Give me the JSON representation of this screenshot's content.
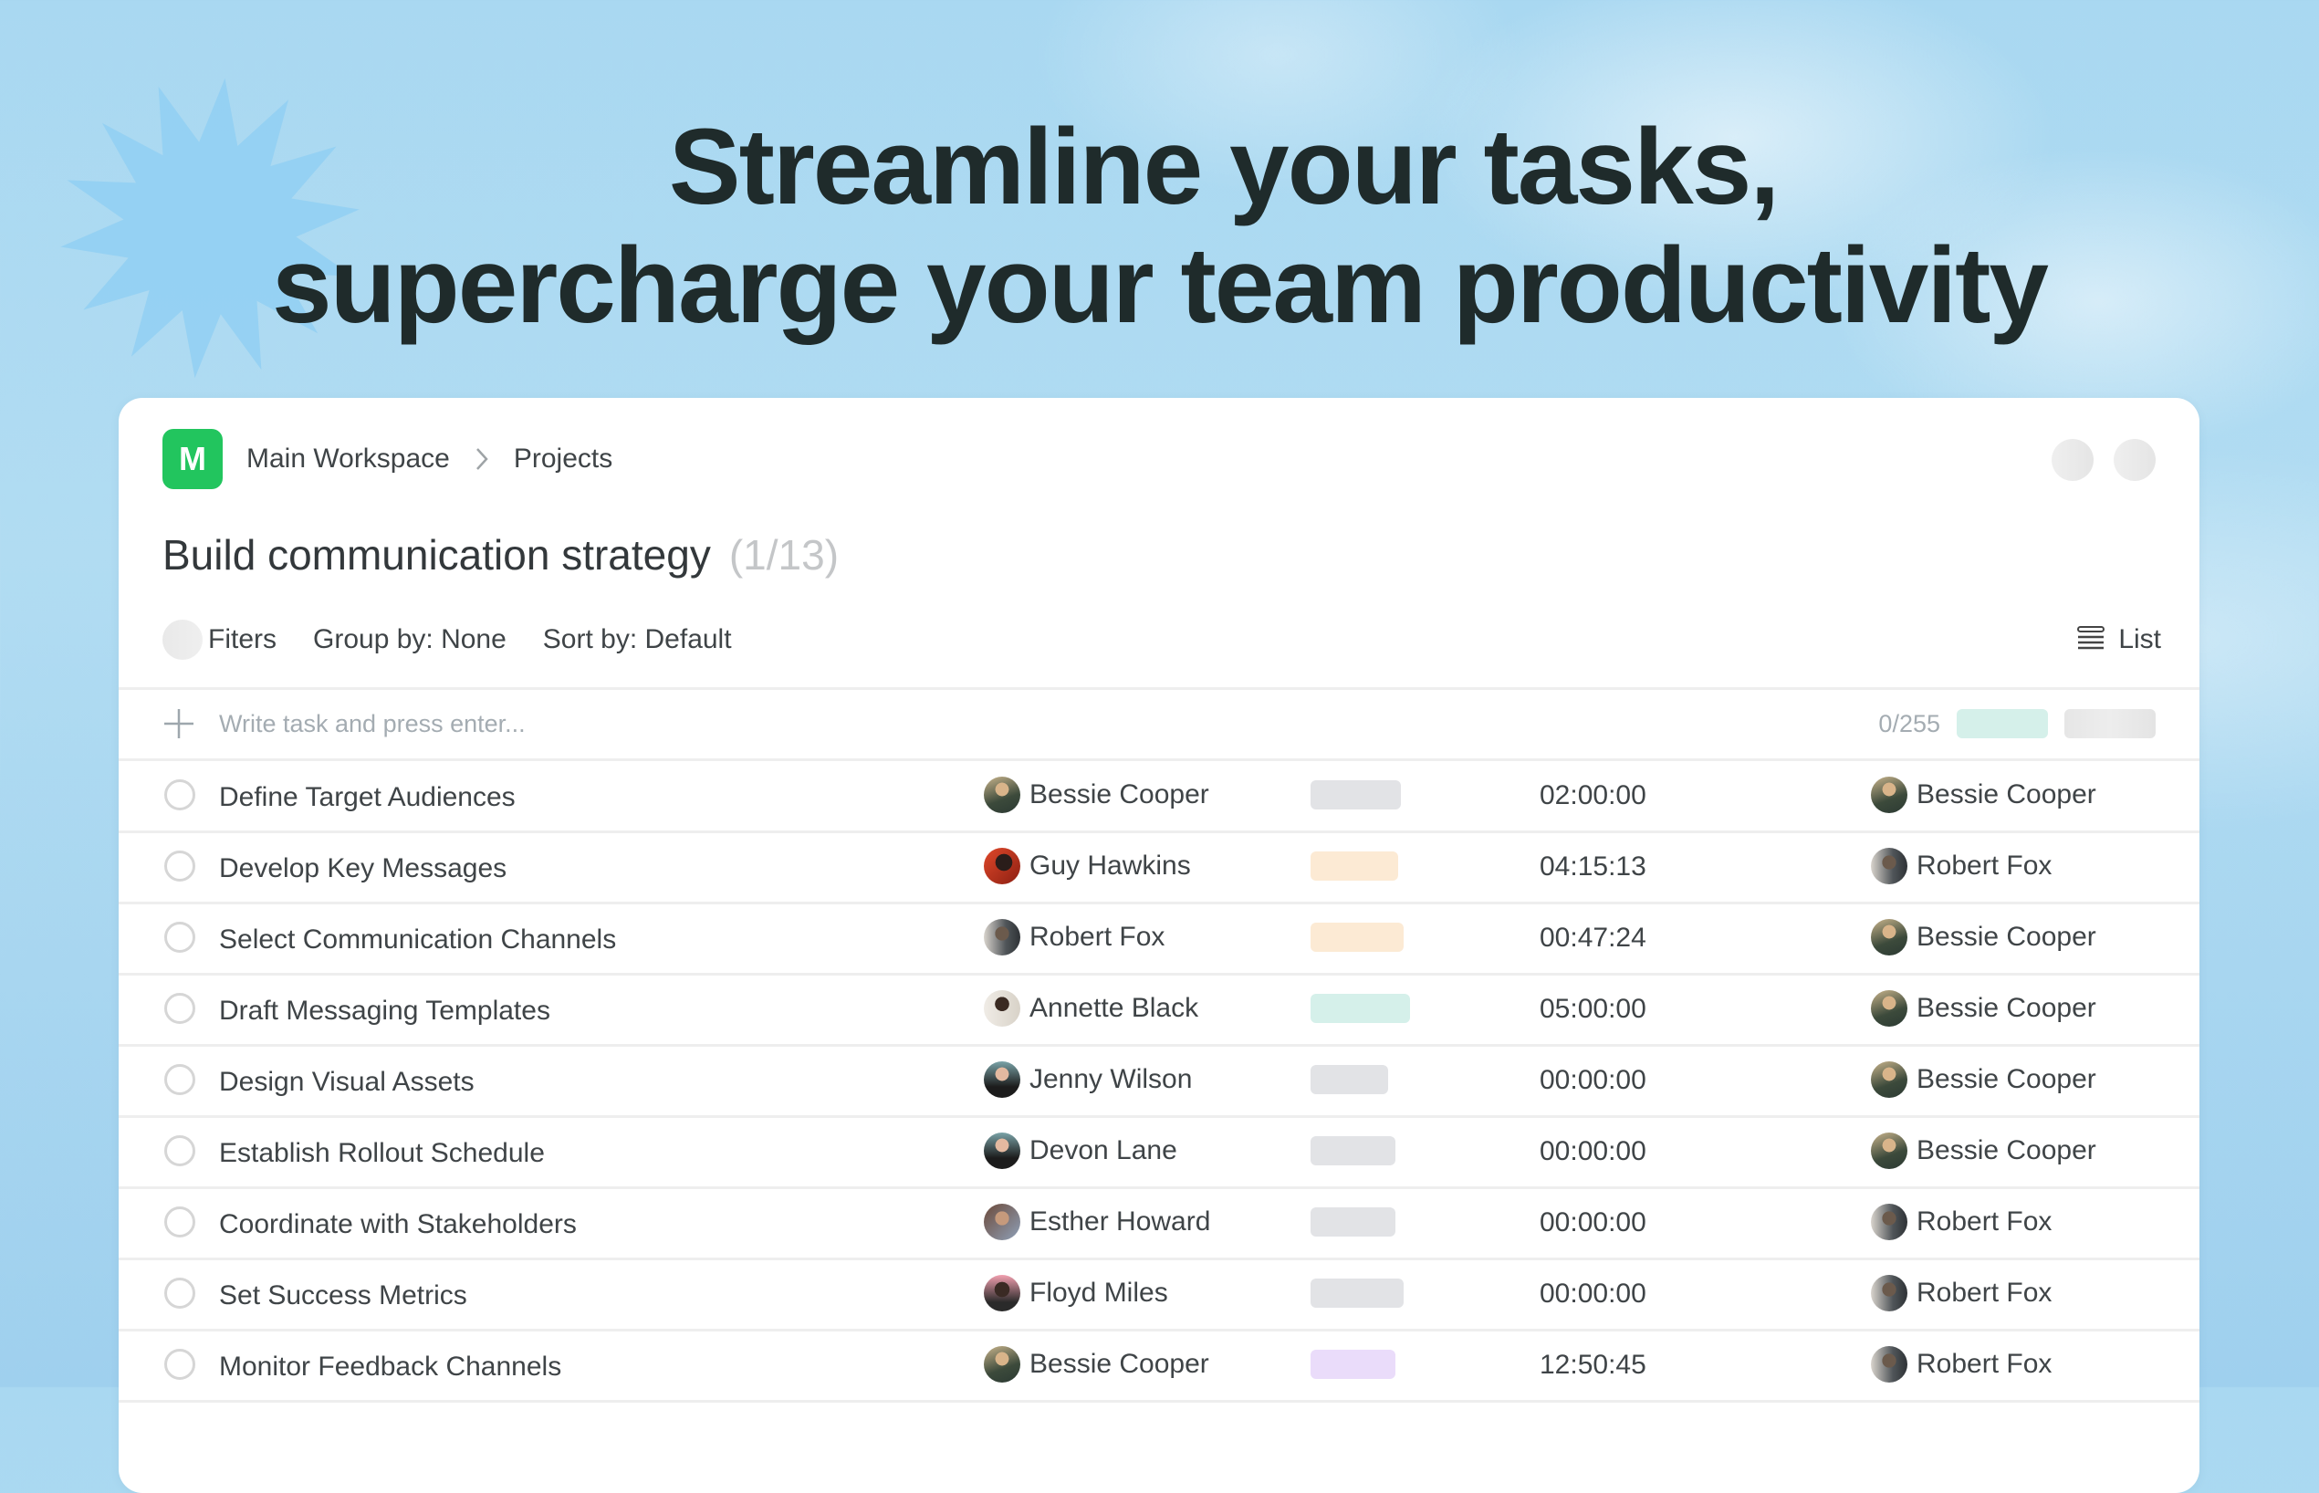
{
  "hero": {
    "headline_line1": "Streamline your tasks,",
    "headline_line2": "supercharge your team productivity"
  },
  "breadcrumb": {
    "workspace_initial": "M",
    "workspace_color": "#22c55e",
    "items": [
      "Main Workspace",
      "Projects"
    ],
    "separator_icon": "chevron-right-icon"
  },
  "project": {
    "title": "Build communication strategy",
    "count": "(1/13)"
  },
  "toolbar": {
    "filters_label": "Fiters",
    "group_by_label": "Group by: None",
    "sort_by_label": "Sort by: Default",
    "view_icon": "list-icon",
    "view_label": "List"
  },
  "new_task": {
    "placeholder": "Write task and press enter...",
    "value": "",
    "char_count": "0/255"
  },
  "status_colors": {
    "gray": "#e2e3e6",
    "orange": "#fcead4",
    "teal": "#d5f0ea",
    "purple": "#eadcfa"
  },
  "tasks": [
    {
      "title": "Define Target Audiences",
      "owner": "Bessie Cooper",
      "status": "gray",
      "status_fill": 0.62,
      "time": "02:00:00",
      "assignee": "Bessie Cooper"
    },
    {
      "title": "Develop Key Messages",
      "owner": "Guy Hawkins",
      "status": "orange",
      "status_fill": 0.6,
      "time": "04:15:13",
      "assignee": "Robert Fox"
    },
    {
      "title": "Select Communication Channels",
      "owner": "Robert Fox",
      "status": "orange",
      "status_fill": 0.64,
      "time": "00:47:24",
      "assignee": "Bessie Cooper"
    },
    {
      "title": "Draft Messaging Templates",
      "owner": "Annette Black",
      "status": "teal",
      "status_fill": 0.68,
      "time": "05:00:00",
      "assignee": "Bessie Cooper"
    },
    {
      "title": "Design Visual Assets",
      "owner": "Jenny Wilson",
      "status": "gray",
      "status_fill": 0.53,
      "time": "00:00:00",
      "assignee": "Bessie Cooper"
    },
    {
      "title": "Establish Rollout Schedule",
      "owner": "Devon Lane",
      "status": "gray",
      "status_fill": 0.58,
      "time": "00:00:00",
      "assignee": "Bessie Cooper"
    },
    {
      "title": "Coordinate with Stakeholders",
      "owner": "Esther Howard",
      "status": "gray",
      "status_fill": 0.58,
      "time": "00:00:00",
      "assignee": "Robert Fox"
    },
    {
      "title": "Set Success Metrics",
      "owner": "Floyd Miles",
      "status": "gray",
      "status_fill": 0.64,
      "time": "00:00:00",
      "assignee": "Robert Fox"
    },
    {
      "title": "Monitor Feedback Channels",
      "owner": "Bessie Cooper",
      "status": "purple",
      "status_fill": 0.58,
      "time": "12:50:45",
      "assignee": "Robert Fox"
    }
  ]
}
